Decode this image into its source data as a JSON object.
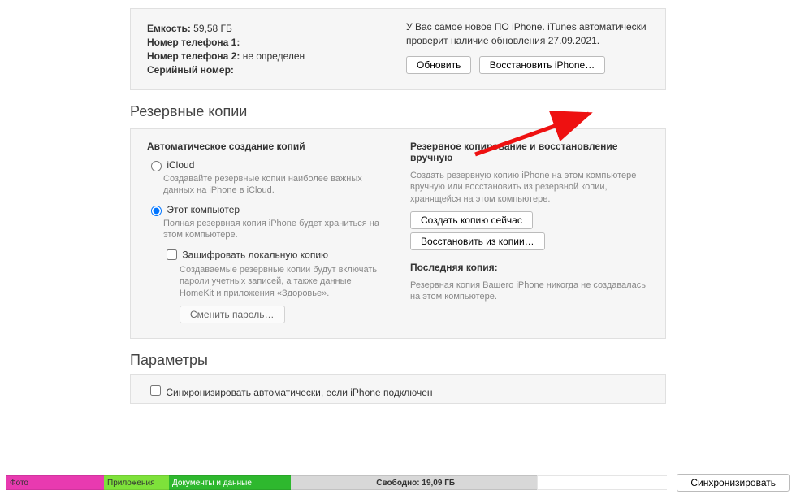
{
  "top": {
    "capacity_label": "Емкость:",
    "capacity_value": "59,58 ГБ",
    "phone1_label": "Номер телефона 1:",
    "phone1_value": "",
    "phone2_label": "Номер телефона 2:",
    "phone2_value": "не определен",
    "serial_label": "Серийный номер:",
    "serial_value": "",
    "update_text": "У Вас самое новое ПО iPhone. iTunes автоматически проверит наличие обновления 27.09.2021.",
    "btn_update": "Обновить",
    "btn_restore": "Восстановить iPhone…"
  },
  "backups": {
    "section": "Резервные копии",
    "auto_heading": "Автоматическое создание копий",
    "icloud_label": "iCloud",
    "icloud_desc": "Создавайте резервные копии наиболее важных данных на iPhone в iCloud.",
    "thispc_label": "Этот компьютер",
    "thispc_desc": "Полная резервная копия iPhone будет храниться на этом компьютере.",
    "encrypt_label": "Зашифровать локальную копию",
    "encrypt_desc": "Создаваемые резервные копии будут включать пароли учетных записей, а также данные HomeKit и приложения «Здоровье».",
    "change_pwd": "Сменить пароль…",
    "manual_heading": "Резервное копирование и восстановление вручную",
    "manual_desc": "Создать резервную копию iPhone на этом компьютере вручную или восстановить из резервной копии, хранящейся на этом компьютере.",
    "btn_backup_now": "Создать копию сейчас",
    "btn_restore_backup": "Восстановить из копии…",
    "last_heading": "Последняя копия:",
    "last_desc": "Резервная копия Вашего iPhone никогда не создавалась на этом компьютере."
  },
  "options": {
    "section": "Параметры",
    "auto_sync": "Синхронизировать автоматически, если iPhone подключен"
  },
  "storage": {
    "photo": "Фото",
    "apps": "Приложения",
    "docs": "Документы и данные",
    "free_label": "Свободно: 19,09 ГБ",
    "sync": "Синхронизировать"
  }
}
